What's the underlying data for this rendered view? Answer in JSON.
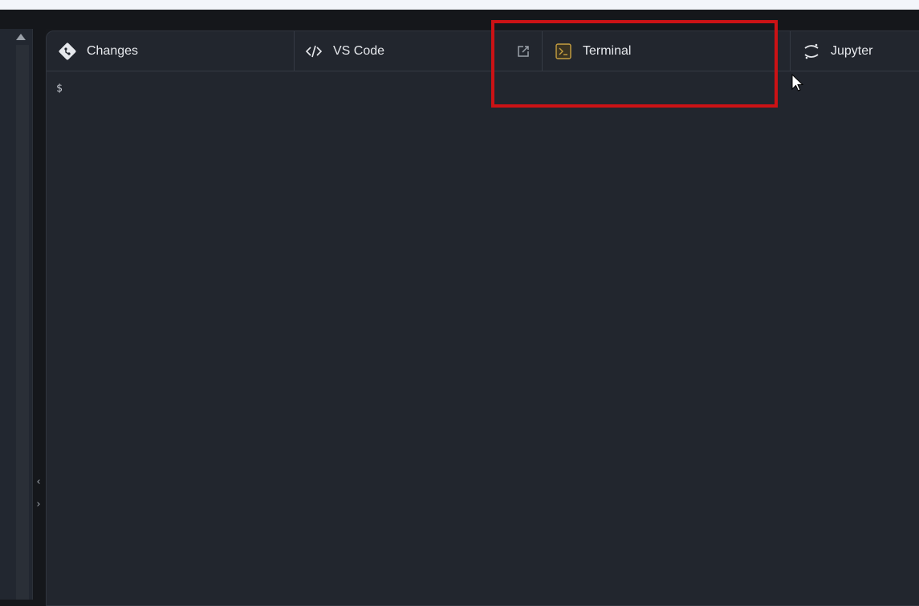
{
  "tabs": {
    "changes": {
      "label": "Changes",
      "icon": "git-diff-icon"
    },
    "vscode": {
      "label": "VS Code",
      "icon": "code-icon"
    },
    "popout": {
      "icon": "external-link-icon"
    },
    "terminal": {
      "label": "Terminal",
      "icon": "terminal-icon",
      "icon_color": "#c8a040"
    },
    "jupyter": {
      "label": "Jupyter",
      "icon": "jupyter-icon"
    }
  },
  "terminal": {
    "prompt": "$"
  },
  "sidebar": {
    "collapse_glyph": "‹",
    "expand_glyph": "›"
  },
  "colors": {
    "highlight": "#cc1215",
    "panel_bg": "#22262e"
  }
}
